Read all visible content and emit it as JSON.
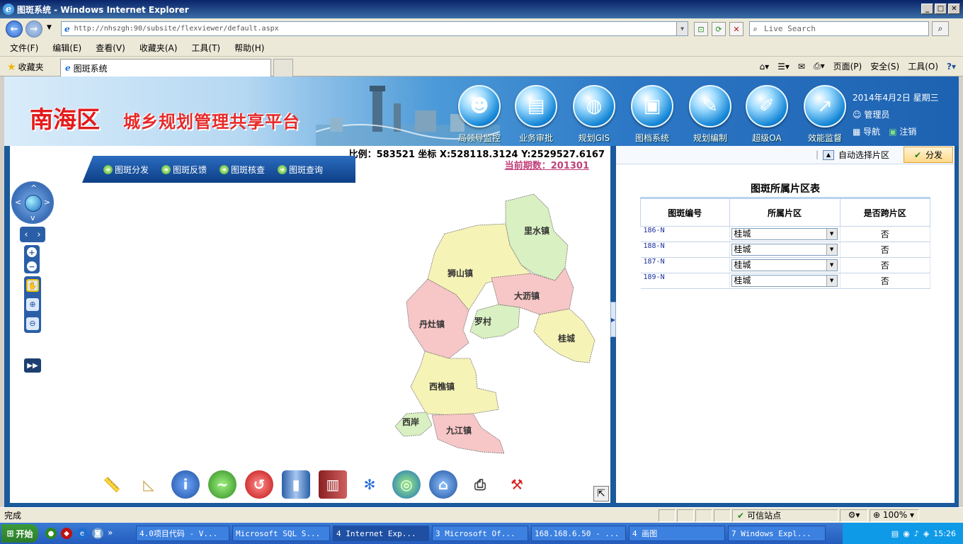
{
  "window": {
    "title": "图斑系统 - Windows Internet Explorer"
  },
  "address": {
    "url": "http://nhszgh:90/subsite/flexviewer/default.aspx",
    "search_placeholder": "Live Search"
  },
  "menu": [
    "文件(F)",
    "编辑(E)",
    "查看(V)",
    "收藏夹(A)",
    "工具(T)",
    "帮助(H)"
  ],
  "tabs": {
    "favorites": "收藏夹",
    "active_tab": "图斑系统"
  },
  "command_bar": {
    "page": "页面(P)",
    "safety": "安全(S)",
    "tools": "工具(O)"
  },
  "banner": {
    "logo_district": "南海区",
    "logo_platform": "城乡规划管理共享平台",
    "nav": [
      {
        "label": "局领导监控",
        "icon": "leader-monitor-icon"
      },
      {
        "label": "业务审批",
        "icon": "document-approval-icon"
      },
      {
        "label": "规划GIS",
        "icon": "globe-icon"
      },
      {
        "label": "图档系统",
        "icon": "archive-icon"
      },
      {
        "label": "规划编制",
        "icon": "plan-edit-icon"
      },
      {
        "label": "超级OA",
        "icon": "office-icon"
      },
      {
        "label": "效能监督",
        "icon": "chart-icon"
      }
    ],
    "date": "2014年4月2日 星期三",
    "user": "管理员",
    "navigate": "导航",
    "logout": "注销"
  },
  "map": {
    "scale_readout": "比例：583521 坐标 X:528118.3124 Y:2529527.6167",
    "period": "当前期数：201301",
    "rail": [
      "图斑分发",
      "图斑反馈",
      "图斑核查",
      "图斑查询"
    ],
    "towns": [
      {
        "name": "里水镇",
        "color": "#d9f0c2"
      },
      {
        "name": "狮山镇",
        "color": "#f6f3b6"
      },
      {
        "name": "大沥镇",
        "color": "#f7c6c6"
      },
      {
        "name": "丹灶镇",
        "color": "#f7c6c6"
      },
      {
        "name": "罗村",
        "color": "#d9f0c2"
      },
      {
        "name": "桂城",
        "color": "#f6f3b6"
      },
      {
        "name": "西樵镇",
        "color": "#f6f3b6"
      },
      {
        "name": "西岸",
        "color": "#d9f0c2"
      },
      {
        "name": "九江镇",
        "color": "#f7c6c6"
      }
    ]
  },
  "panel": {
    "auto_select": "自动选择片区",
    "send": "分发",
    "title": "图斑所属片区表",
    "headers": [
      "图斑编号",
      "所属片区",
      "是否跨片区"
    ],
    "rows": [
      {
        "code": "186-N",
        "district": "桂城",
        "cross": "否"
      },
      {
        "code": "188-N",
        "district": "桂城",
        "cross": "否"
      },
      {
        "code": "187-N",
        "district": "桂城",
        "cross": "否"
      },
      {
        "code": "189-N",
        "district": "桂城",
        "cross": "否"
      }
    ]
  },
  "status": {
    "done": "完成",
    "zone": "可信站点",
    "zoom": "100%"
  },
  "taskbar": {
    "start": "开始",
    "tasks": [
      "4.0项目代码 - V...",
      "Microsoft SQL S...",
      "4 Internet Exp...",
      "3 Microsoft Of...",
      "168.168.6.50 - ...",
      "4 画图",
      "7 Windows Expl..."
    ],
    "clock": "15:26"
  }
}
